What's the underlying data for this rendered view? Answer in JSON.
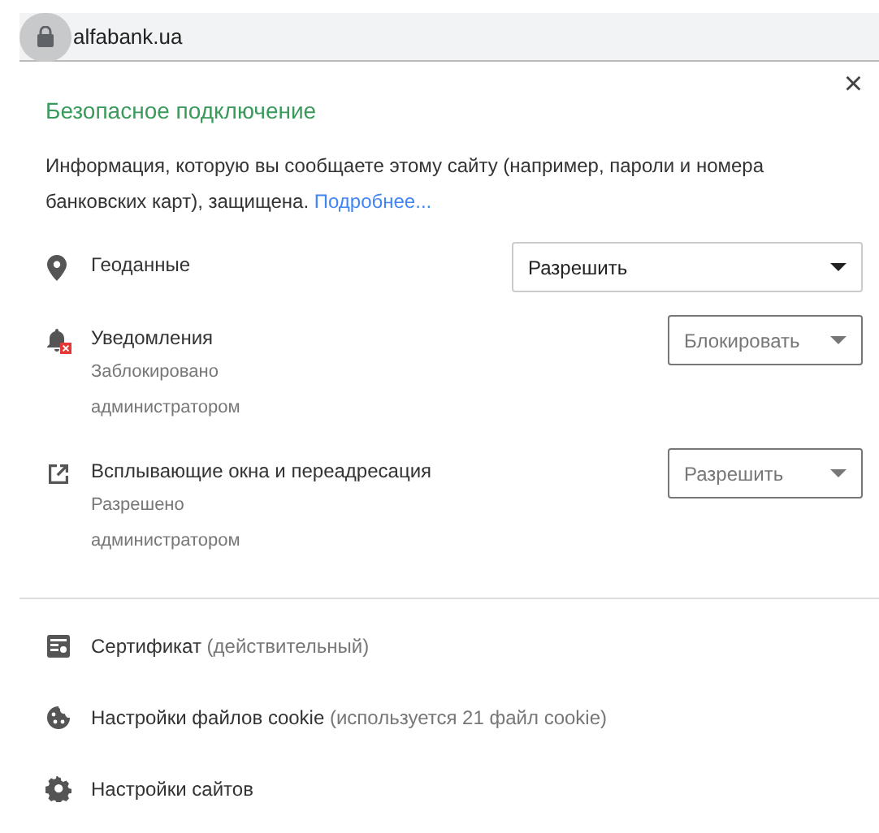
{
  "address_bar": {
    "url": "alfabank.ua",
    "secure": true
  },
  "popup": {
    "title": "Безопасное подключение",
    "description": "Информация, которую вы сообщаете этому сайту (например, пароли и номера банковских карт), защищена.",
    "link": "Подробнее...",
    "close": "×"
  },
  "permissions": [
    {
      "kind": "location",
      "label": "Геоданные",
      "value": "Разрешить",
      "disabled": false
    },
    {
      "kind": "notifications-blocked",
      "label": "Уведомления",
      "value": "Блокировать",
      "disabled": true,
      "note": "Заблокировано администратором"
    },
    {
      "kind": "popup",
      "label": "Всплывающие окна и переадресация",
      "value": "Разрешить",
      "disabled": true,
      "note": "Разрешено администратором"
    }
  ],
  "links": [
    {
      "kind": "certificate",
      "label": "Сертификат",
      "detail": "(действительный)"
    },
    {
      "kind": "cookie",
      "label": "Настройки файлов cookie",
      "detail": "(используется 21 файл cookie)"
    },
    {
      "kind": "gear",
      "label": "Настройки сайтов"
    }
  ]
}
